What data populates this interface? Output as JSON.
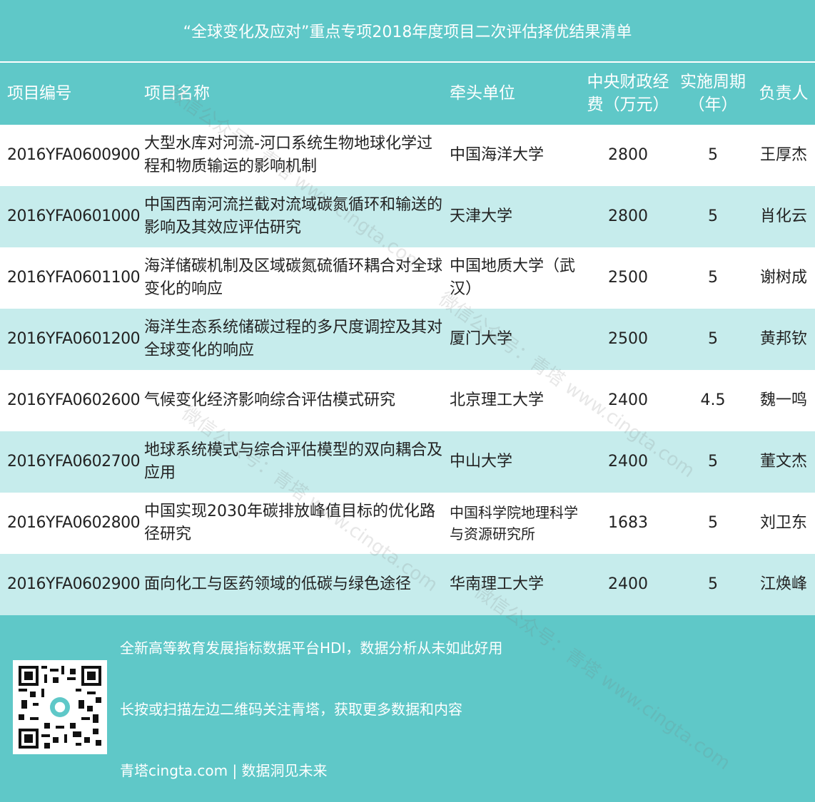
{
  "title": "“全球变化及应对”重点专项2018年度项目二次评估择优结果清单",
  "headers": {
    "id": "项目编号",
    "name": "项目名称",
    "org": "牵头单位",
    "funding_line1": "中央财政经",
    "funding_line2": "费（万元）",
    "period_line1": "实施周期",
    "period_line2": "（年）",
    "lead": "负责人"
  },
  "rows": [
    {
      "id": "2016YFA0600900",
      "name": "大型水库对河流-河口系统生物地球化学过程和物质输运的影响机制",
      "org": "中国海洋大学",
      "funding": "2800",
      "period": "5",
      "lead": "王厚杰"
    },
    {
      "id": "2016YFA0601000",
      "name": "中国西南河流拦截对流域碳氮循环和输送的影响及其效应评估研究",
      "org": "天津大学",
      "funding": "2800",
      "period": "5",
      "lead": "肖化云"
    },
    {
      "id": "2016YFA0601100",
      "name": "海洋储碳机制及区域碳氮硫循环耦合对全球变化的响应",
      "org": "中国地质大学（武汉）",
      "funding": "2500",
      "period": "5",
      "lead": "谢树成"
    },
    {
      "id": "2016YFA0601200",
      "name": "海洋生态系统储碳过程的多尺度调控及其对全球变化的响应",
      "org": "厦门大学",
      "funding": "2500",
      "period": "5",
      "lead": "黄邦钦"
    },
    {
      "id": "2016YFA0602600",
      "name": "气候变化经济影响综合评估模式研究",
      "org": "北京理工大学",
      "funding": "2400",
      "period": "4.5",
      "lead": "魏一鸣"
    },
    {
      "id": "2016YFA0602700",
      "name": "地球系统模式与综合评估模型的双向耦合及应用",
      "org": "中山大学",
      "funding": "2400",
      "period": "5",
      "lead": "董文杰"
    },
    {
      "id": "2016YFA0602800",
      "name": "中国实现2030年碳排放峰值目标的优化路径研究",
      "org": "中国科学院地理科学与资源研究所",
      "funding": "1683",
      "period": "5",
      "lead": "刘卫东"
    },
    {
      "id": "2016YFA0602900",
      "name": "面向化工与医药领域的低碳与绿色途径",
      "org": "华南理工大学",
      "funding": "2400",
      "period": "5",
      "lead": "江焕峰"
    }
  ],
  "footer": {
    "line1": "全新高等教育发展指标数据平台HDI，数据分析从未如此好用",
    "line2": "长按或扫描左边二维码关注青塔，获取更多数据和内容",
    "line3": "青塔cingta.com | 数据洞见未来"
  },
  "watermark": "微信公众号：青塔  www.cingta.com",
  "colors": {
    "teal": "#5fc8c8",
    "stripe": "#c6ecec"
  }
}
